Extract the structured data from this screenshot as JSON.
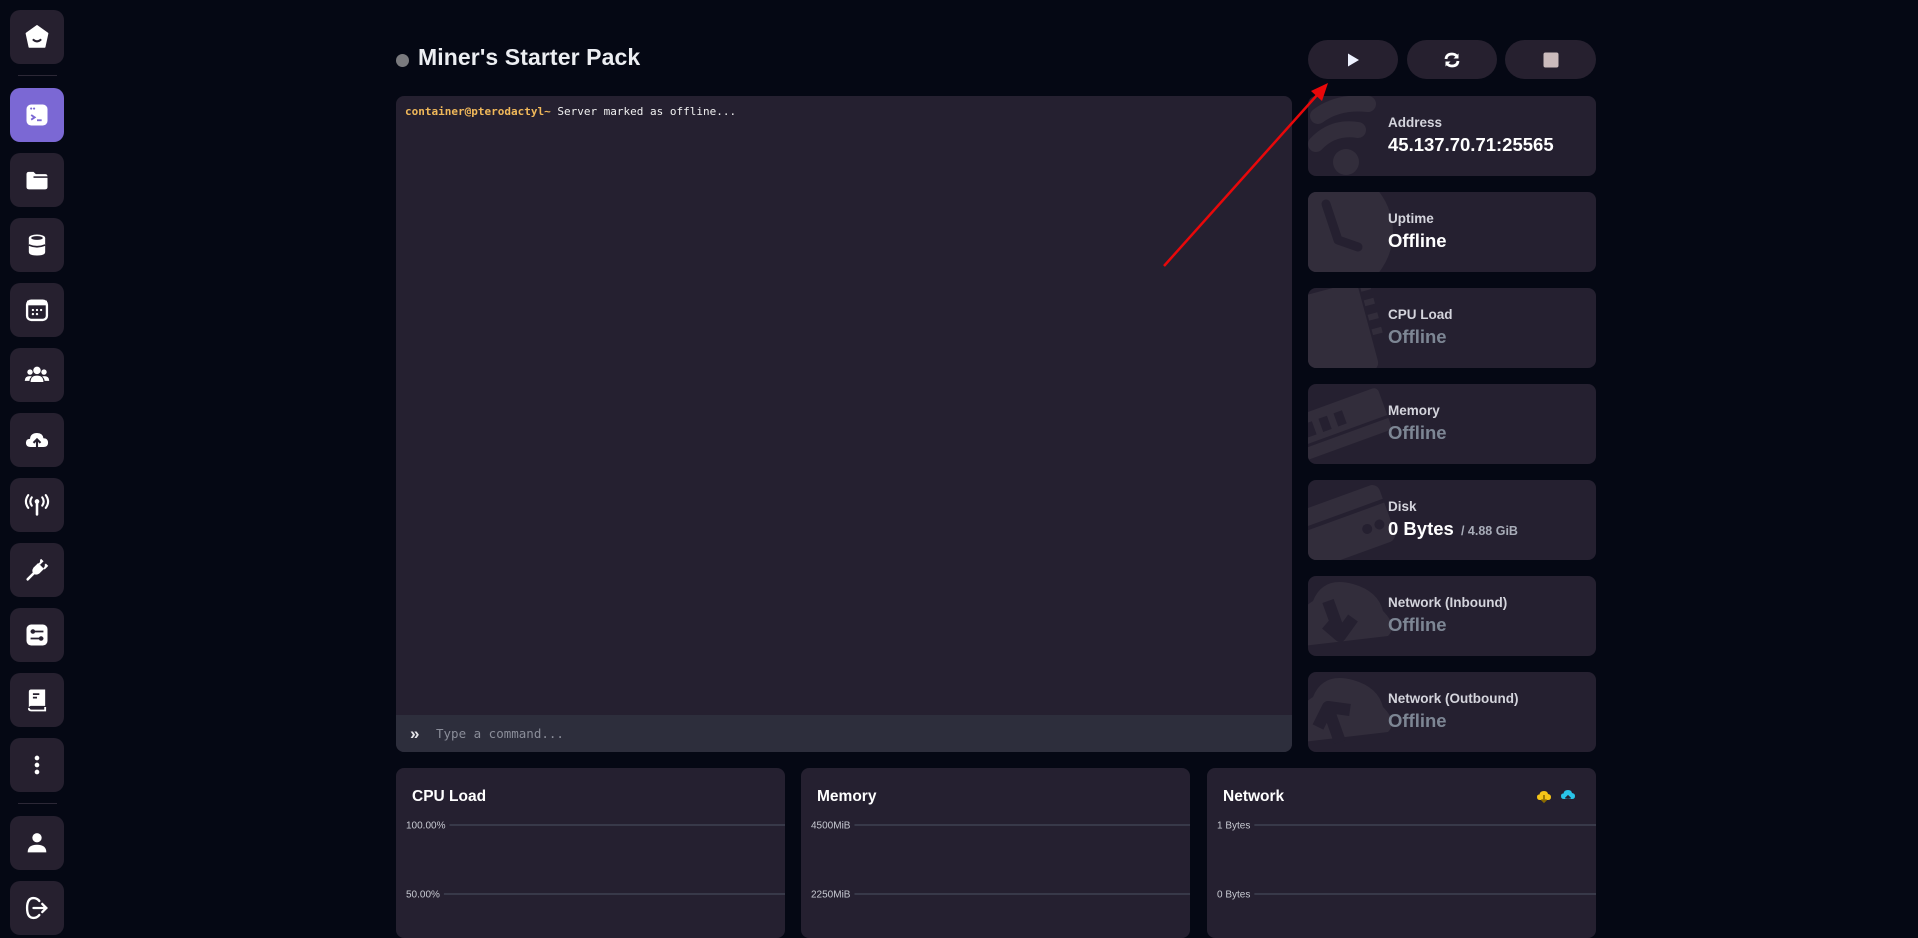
{
  "sidebar": {
    "items": [
      {
        "name": "home",
        "icon": "home-icon",
        "active": false
      },
      {
        "name": "console",
        "icon": "terminal-icon",
        "active": true
      },
      {
        "name": "files",
        "icon": "folder-icon",
        "active": false
      },
      {
        "name": "databases",
        "icon": "database-icon",
        "active": false
      },
      {
        "name": "schedules",
        "icon": "calendar-icon",
        "active": false
      },
      {
        "name": "users",
        "icon": "users-icon",
        "active": false
      },
      {
        "name": "backups",
        "icon": "cloud-upload-icon",
        "active": false
      },
      {
        "name": "network",
        "icon": "antenna-icon",
        "active": false
      },
      {
        "name": "startup",
        "icon": "plug-icon",
        "active": false
      },
      {
        "name": "settings",
        "icon": "sliders-icon",
        "active": false
      },
      {
        "name": "activity",
        "icon": "book-icon",
        "active": false
      },
      {
        "name": "more",
        "icon": "kebab-icon",
        "active": false
      },
      {
        "name": "account",
        "icon": "user-icon",
        "active": false
      },
      {
        "name": "logout",
        "icon": "logout-icon",
        "active": false
      }
    ]
  },
  "header": {
    "title": "Miner's Starter Pack",
    "status": "offline",
    "status_color": "#7a7a7e"
  },
  "controls": {
    "start": {
      "icon": "play-icon",
      "label": "Start"
    },
    "restart": {
      "icon": "restart-icon",
      "label": "Restart"
    },
    "stop": {
      "icon": "stop-icon",
      "label": "Stop"
    }
  },
  "console": {
    "prompt": "container@pterodactyl~",
    "lines": [
      "Server marked as offline..."
    ],
    "input_placeholder": "Type a command...",
    "input_value": ""
  },
  "stats": [
    {
      "key": "address",
      "label": "Address",
      "value": "45.137.70.71:25565",
      "muted": false,
      "icon": "wifi-icon"
    },
    {
      "key": "uptime",
      "label": "Uptime",
      "value": "Offline",
      "muted": false,
      "icon": "clock-icon"
    },
    {
      "key": "cpu",
      "label": "CPU Load",
      "value": "Offline",
      "muted": true,
      "icon": "cpu-icon"
    },
    {
      "key": "memory",
      "label": "Memory",
      "value": "Offline",
      "muted": true,
      "icon": "memory-icon"
    },
    {
      "key": "disk",
      "label": "Disk",
      "value": "0 Bytes",
      "sub": "/ 4.88 GiB",
      "muted": false,
      "icon": "hdd-icon"
    },
    {
      "key": "net_in",
      "label": "Network (Inbound)",
      "value": "Offline",
      "muted": true,
      "icon": "cloud-download-icon"
    },
    {
      "key": "net_out",
      "label": "Network (Outbound)",
      "value": "Offline",
      "muted": true,
      "icon": "cloud-upload-icon"
    }
  ],
  "colors": {
    "accent": "#7b68d4",
    "annotation_arrow": "#e8080a",
    "inbound": "#f5c518",
    "outbound": "#29c4e8"
  },
  "chart_data": [
    {
      "type": "line",
      "title": "CPU Load",
      "ytick_labels": [
        "100.00%",
        "50.00%"
      ],
      "yticks": [
        100,
        50
      ],
      "ylim": [
        0,
        100
      ],
      "series": [],
      "grid": true
    },
    {
      "type": "line",
      "title": "Memory",
      "ytick_labels": [
        "4500MiB",
        "2250MiB"
      ],
      "yticks": [
        4500,
        2250
      ],
      "ylim": [
        0,
        4500
      ],
      "series": [],
      "grid": true
    },
    {
      "type": "line",
      "title": "Network",
      "ytick_labels": [
        "1 Bytes",
        "0 Bytes"
      ],
      "yticks": [
        1,
        0
      ],
      "ylim": [
        0,
        1
      ],
      "series": [
        {
          "name": "Inbound",
          "icon": "cloud-download-icon",
          "values": []
        },
        {
          "name": "Outbound",
          "icon": "cloud-upload-icon",
          "values": []
        }
      ],
      "legend": "top-right",
      "grid": true
    }
  ]
}
